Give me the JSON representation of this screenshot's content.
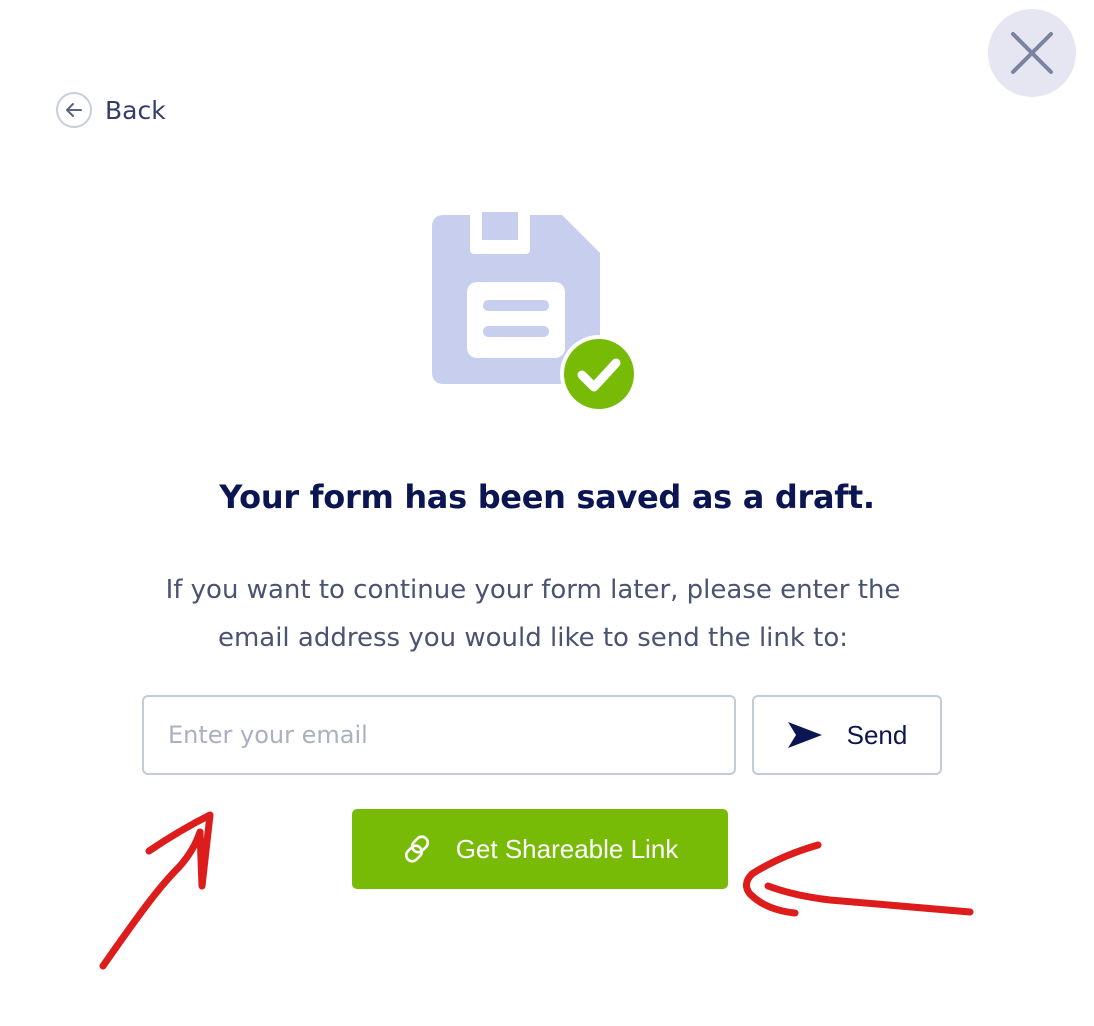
{
  "header": {
    "back_label": "Back"
  },
  "main": {
    "title": "Your form has been saved as a draft.",
    "description_line1": "If you want to continue your form later, please enter the",
    "description_line2": "email address you would like to send the link to:",
    "email": {
      "value": "",
      "placeholder": "Enter your email"
    },
    "send_label": "Send",
    "share_label": "Get Shareable Link"
  },
  "icons": {
    "close": "close-icon",
    "back": "arrow-left-icon",
    "hero": "floppy-disk-saved-icon",
    "check": "check-icon",
    "send": "send-arrow-icon",
    "link": "link-icon"
  },
  "colors": {
    "primary_text": "#0a1551",
    "body_text": "#4a5371",
    "accent_green": "#78bb07",
    "disk_fill": "#c8ceed",
    "close_bg": "#e6e6f3",
    "annotation_red": "#dd1c1c"
  }
}
